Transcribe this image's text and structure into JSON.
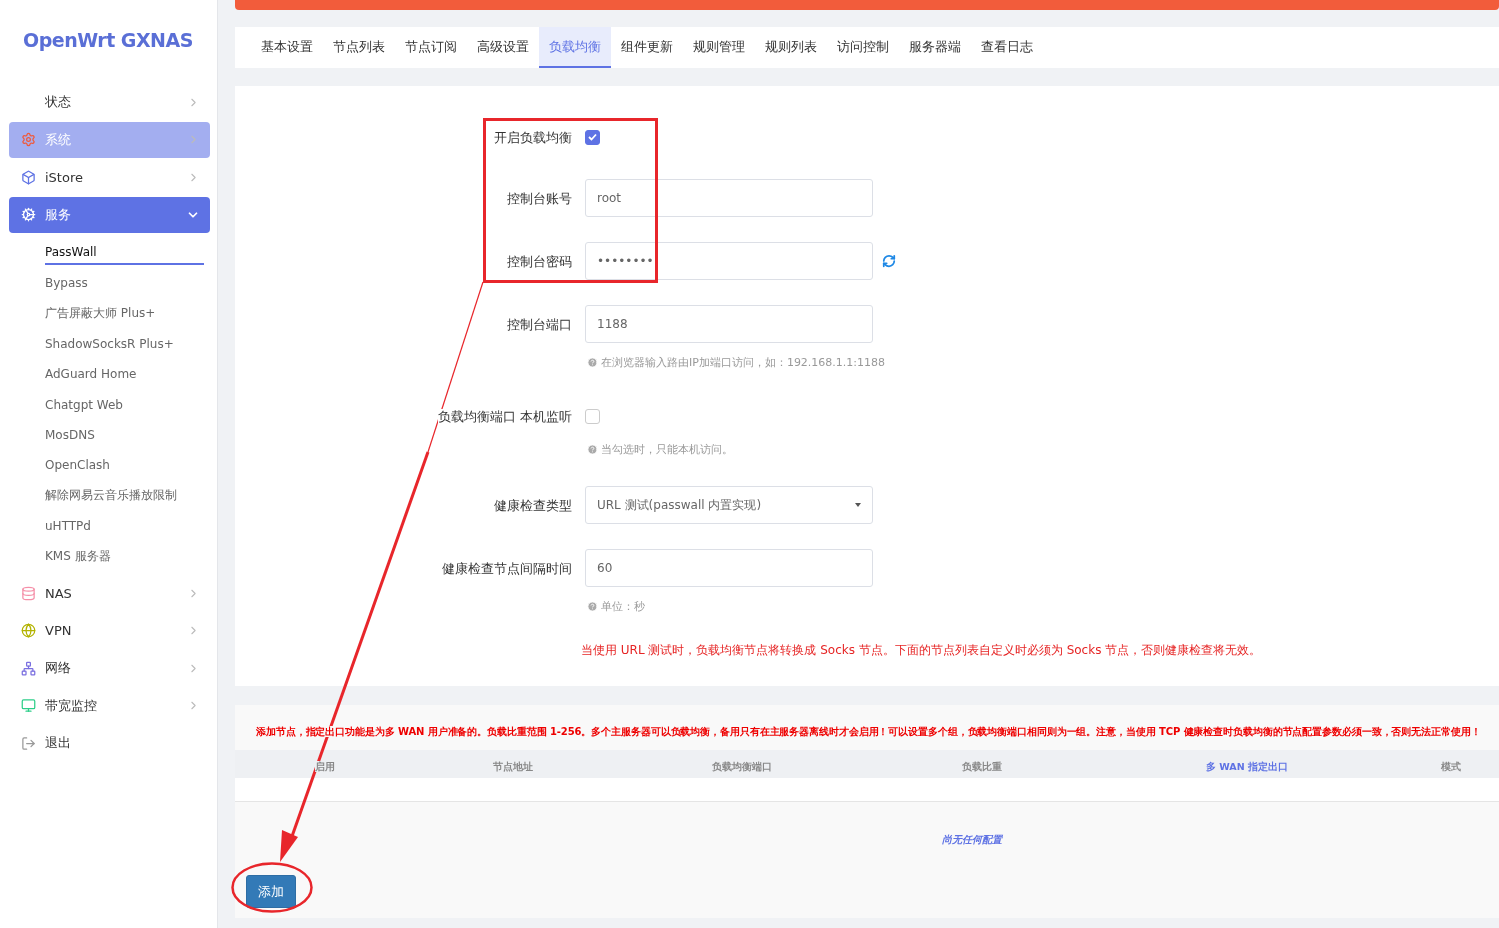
{
  "brand": "OpenWrt GXNAS",
  "sidebar": {
    "items": [
      {
        "label": "状态",
        "selected": false,
        "hovered": false,
        "expandable": true
      },
      {
        "label": "系统",
        "selected": false,
        "hovered": true,
        "expandable": true
      },
      {
        "label": "iStore",
        "selected": false,
        "hovered": false,
        "expandable": true
      },
      {
        "label": "服务",
        "selected": true,
        "hovered": false,
        "expandable": true,
        "expanded": true,
        "children": [
          {
            "label": "PassWall",
            "selected": true
          },
          {
            "label": "Bypass",
            "selected": false
          },
          {
            "label": "广告屏蔽大师 Plus+",
            "selected": false
          },
          {
            "label": "ShadowSocksR Plus+",
            "selected": false
          },
          {
            "label": "AdGuard Home",
            "selected": false
          },
          {
            "label": "Chatgpt Web",
            "selected": false
          },
          {
            "label": "MosDNS",
            "selected": false
          },
          {
            "label": "OpenClash",
            "selected": false
          },
          {
            "label": "解除网易云音乐播放限制",
            "selected": false
          },
          {
            "label": "uHTTPd",
            "selected": false
          },
          {
            "label": "KMS 服务器",
            "selected": false
          }
        ]
      },
      {
        "label": "NAS",
        "selected": false,
        "hovered": false,
        "expandable": true
      },
      {
        "label": "VPN",
        "selected": false,
        "hovered": false,
        "expandable": true
      },
      {
        "label": "网络",
        "selected": false,
        "hovered": false,
        "expandable": true
      },
      {
        "label": "带宽监控",
        "selected": false,
        "hovered": false,
        "expandable": true
      },
      {
        "label": "退出",
        "selected": false,
        "hovered": false,
        "expandable": false
      }
    ]
  },
  "tabs": [
    {
      "label": "基本设置",
      "selected": false
    },
    {
      "label": "节点列表",
      "selected": false
    },
    {
      "label": "节点订阅",
      "selected": false
    },
    {
      "label": "高级设置",
      "selected": false
    },
    {
      "label": "负载均衡",
      "selected": true
    },
    {
      "label": "组件更新",
      "selected": false
    },
    {
      "label": "规则管理",
      "selected": false
    },
    {
      "label": "规则列表",
      "selected": false
    },
    {
      "label": "访问控制",
      "selected": false
    },
    {
      "label": "服务器端",
      "selected": false
    },
    {
      "label": "查看日志",
      "selected": false
    }
  ],
  "form": {
    "fields": [
      {
        "kind": "checkbox",
        "label": "开启负载均衡",
        "checked": true
      },
      {
        "kind": "text",
        "label": "控制台账号",
        "value": "root"
      },
      {
        "kind": "password",
        "label": "控制台密码",
        "value": "••••••••"
      },
      {
        "kind": "text",
        "label": "控制台端口",
        "value": "1188",
        "hint": "在浏览器输入路由IP加端口访问，如：192.168.1.1:1188"
      },
      {
        "kind": "checkbox",
        "label": "负载均衡端口 本机监听",
        "checked": false,
        "hint": "当勾选时，只能本机访问。"
      },
      {
        "kind": "select",
        "label": "健康检查类型",
        "value": "URL 测试(passwall 内置实现)"
      },
      {
        "kind": "text",
        "label": "健康检查节点间隔时间",
        "value": "60",
        "hint": "单位：秒"
      }
    ],
    "warning": "当使用 URL 测试时，负载均衡节点将转换成 Socks 节点。下面的节点列表自定义时必须为 Socks 节点，否则健康检查将无效。"
  },
  "nodes": {
    "note": "添加节点，指定出口功能是为多 WAN 用户准备的。负载比重范围 1-256。多个主服务器可以负载均衡，备用只有在主服务器离线时才会启用！可以设置多个组，负载均衡端口相同则为一组。注意，当使用 TCP 健康检查时负载均衡的节点配置参数必须一致，否则无法正常使用！",
    "columns": [
      {
        "label": "启用",
        "highlighted": false
      },
      {
        "label": "节点地址",
        "highlighted": false
      },
      {
        "label": "负载均衡端口",
        "highlighted": false
      },
      {
        "label": "负载比重",
        "highlighted": false
      },
      {
        "label": "多 WAN 指定出口",
        "highlighted": true
      },
      {
        "label": "模式",
        "highlighted": false
      }
    ],
    "empty": "尚无任何配置",
    "add_button": "添加"
  }
}
